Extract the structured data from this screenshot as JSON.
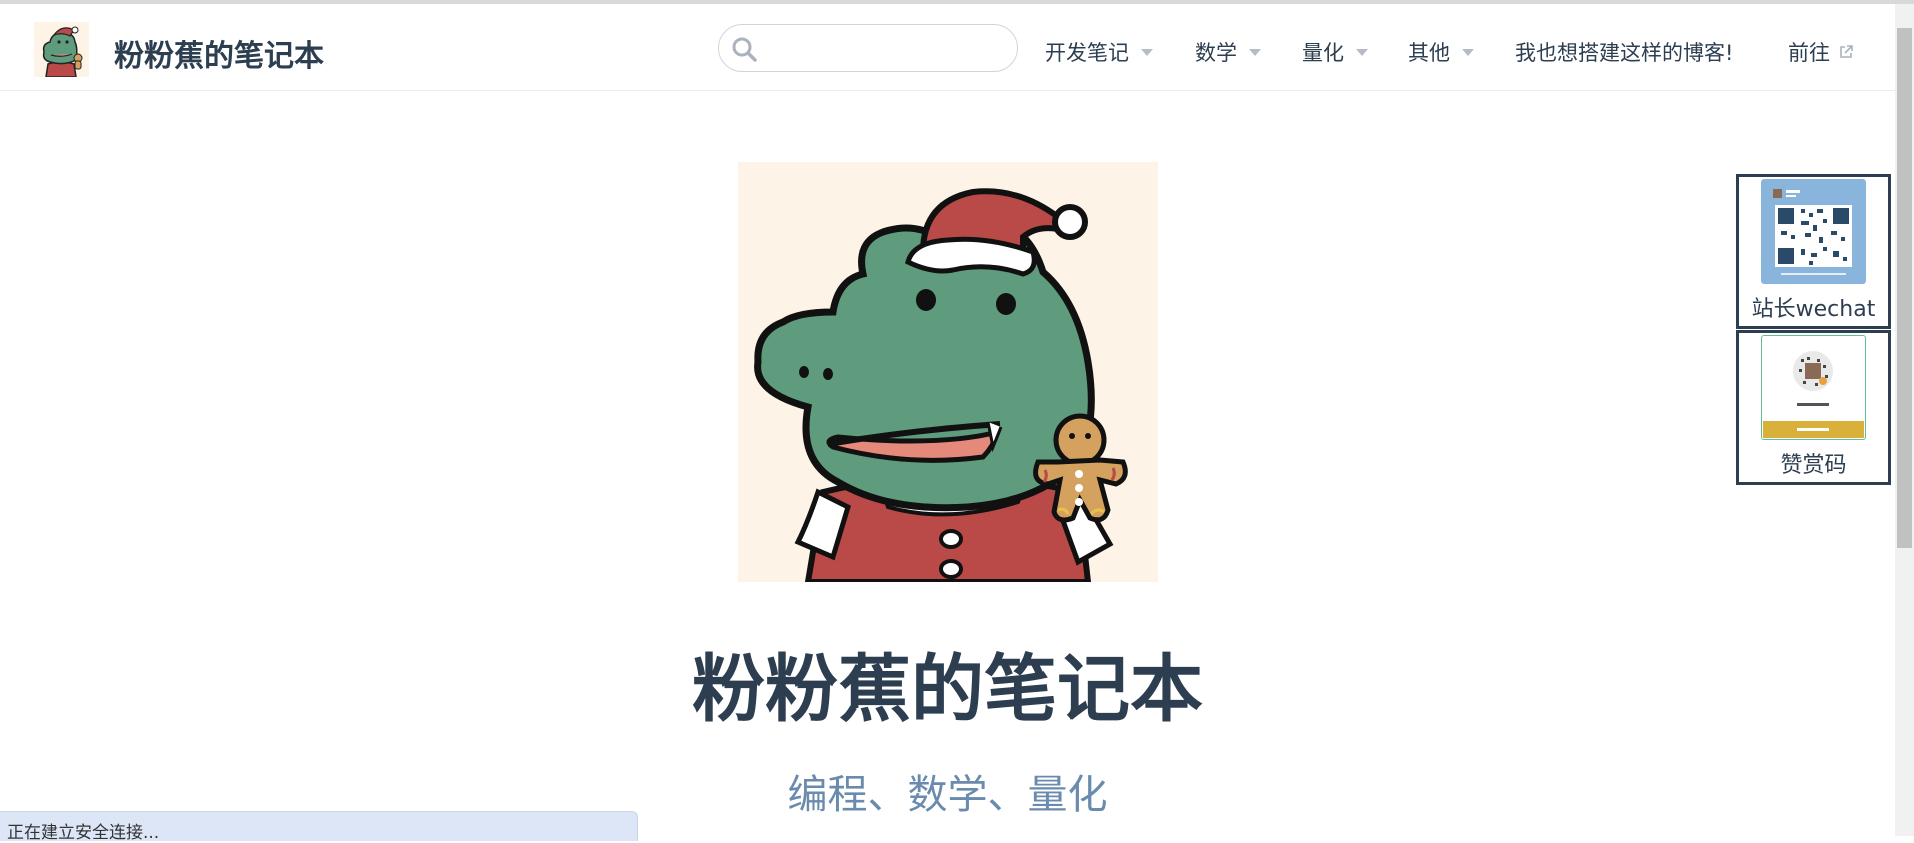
{
  "navbar": {
    "site_name": "粉粉蕉的笔记本",
    "search": {
      "value": "",
      "placeholder": ""
    },
    "items": [
      {
        "label": "开发笔记",
        "dropdown": true
      },
      {
        "label": "数学",
        "dropdown": true
      },
      {
        "label": "量化",
        "dropdown": true
      },
      {
        "label": "其他",
        "dropdown": true
      },
      {
        "label": "我也想搭建这样的博客!",
        "dropdown": false
      },
      {
        "label": "前往",
        "external": true
      }
    ]
  },
  "hero": {
    "title": "粉粉蕉的笔记本",
    "description": "编程、数学、量化"
  },
  "side_cards": [
    {
      "label": "站长wechat"
    },
    {
      "label": "赞赏码"
    }
  ],
  "status_bar": {
    "text": "正在建立安全连接..."
  },
  "icons": [
    "site-logo-icon",
    "search-icon",
    "chevron-down-icon",
    "external-link-icon",
    "wechat-qr-icon",
    "donate-qr-icon"
  ],
  "colors": {
    "text": "#2c3e50",
    "description": "#6a8bad",
    "avatar_bg": "#fdf3e6",
    "croc_green": "#5f9b7d",
    "santa_red": "#b94a48"
  }
}
